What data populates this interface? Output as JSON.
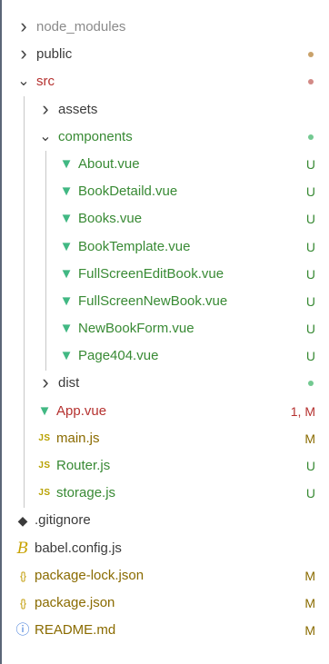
{
  "explorer": {
    "items": [
      {
        "label": "node_modules",
        "kind": "folder",
        "expanded": false,
        "depth": 0,
        "status": "",
        "dot": "",
        "icon": "",
        "label_color": "#8a8a8a"
      },
      {
        "label": "public",
        "kind": "folder",
        "expanded": false,
        "depth": 0,
        "status": "",
        "dot": "#c9a26b",
        "icon": ""
      },
      {
        "label": "src",
        "kind": "folder",
        "expanded": true,
        "depth": 0,
        "status": "",
        "dot": "#d28a86",
        "icon": "",
        "label_color": "#b5312f"
      },
      {
        "label": "assets",
        "kind": "folder",
        "expanded": false,
        "depth": 1,
        "status": "",
        "dot": "",
        "icon": ""
      },
      {
        "label": "components",
        "kind": "folder",
        "expanded": true,
        "depth": 1,
        "status": "",
        "dot": "#73c991",
        "icon": "",
        "label_color": "#388a34"
      },
      {
        "label": "About.vue",
        "kind": "file",
        "depth": 2,
        "status": "U",
        "icon": "vue-icon",
        "label_color": "#388a34"
      },
      {
        "label": "BookDetaild.vue",
        "kind": "file",
        "depth": 2,
        "status": "U",
        "icon": "vue-icon",
        "label_color": "#388a34"
      },
      {
        "label": "Books.vue",
        "kind": "file",
        "depth": 2,
        "status": "U",
        "icon": "vue-icon",
        "label_color": "#388a34"
      },
      {
        "label": "BookTemplate.vue",
        "kind": "file",
        "depth": 2,
        "status": "U",
        "icon": "vue-icon",
        "label_color": "#388a34"
      },
      {
        "label": "FullScreenEditBook.vue",
        "kind": "file",
        "depth": 2,
        "status": "U",
        "icon": "vue-icon",
        "label_color": "#388a34"
      },
      {
        "label": "FullScreenNewBook.vue",
        "kind": "file",
        "depth": 2,
        "status": "U",
        "icon": "vue-icon",
        "label_color": "#388a34"
      },
      {
        "label": "NewBookForm.vue",
        "kind": "file",
        "depth": 2,
        "status": "U",
        "icon": "vue-icon",
        "label_color": "#388a34"
      },
      {
        "label": "Page404.vue",
        "kind": "file",
        "depth": 2,
        "status": "U",
        "icon": "vue-icon",
        "label_color": "#388a34"
      },
      {
        "label": "dist",
        "kind": "folder",
        "expanded": false,
        "depth": 1,
        "status": "",
        "dot": "#73c991",
        "icon": ""
      },
      {
        "label": "App.vue",
        "kind": "file",
        "depth": 1,
        "status": "1, M",
        "icon": "vue-icon",
        "label_color": "#b5312f",
        "status_color": "#b5312f"
      },
      {
        "label": "main.js",
        "kind": "file",
        "depth": 1,
        "status": "M",
        "icon": "js-icon",
        "label_color": "#8a6b00"
      },
      {
        "label": "Router.js",
        "kind": "file",
        "depth": 1,
        "status": "U",
        "icon": "js-icon",
        "label_color": "#388a34"
      },
      {
        "label": "storage.js",
        "kind": "file",
        "depth": 1,
        "status": "U",
        "icon": "js-icon",
        "label_color": "#388a34"
      },
      {
        "label": ".gitignore",
        "kind": "file",
        "depth": 0,
        "status": "",
        "icon": "git-icon"
      },
      {
        "label": "babel.config.js",
        "kind": "file",
        "depth": 0,
        "status": "",
        "icon": "babel-icon"
      },
      {
        "label": "package-lock.json",
        "kind": "file",
        "depth": 0,
        "status": "M",
        "icon": "json-icon",
        "label_color": "#8a6b00"
      },
      {
        "label": "package.json",
        "kind": "file",
        "depth": 0,
        "status": "M",
        "icon": "json-icon",
        "label_color": "#8a6b00"
      },
      {
        "label": "README.md",
        "kind": "file",
        "depth": 0,
        "status": "M",
        "icon": "info-icon",
        "label_color": "#8a6b00"
      }
    ],
    "icon_glyphs": {
      "vue-icon": "▼",
      "js-icon": "JS",
      "git-icon": "◆",
      "babel-icon": "B",
      "json-icon": "{}",
      "info-icon": "ⓘ"
    },
    "colors": {
      "untracked": "#388a34",
      "modified": "#8a6b00",
      "error": "#b5312f"
    }
  }
}
